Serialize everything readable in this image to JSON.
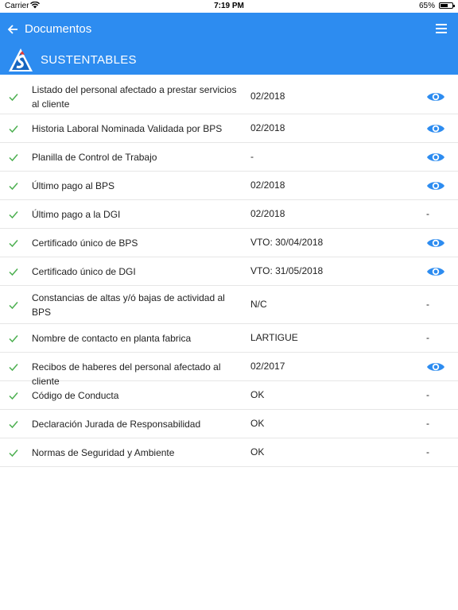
{
  "status_bar": {
    "carrier": "Carrier",
    "time": "7:19 PM",
    "battery": "65%",
    "battery_level": 0.65
  },
  "app_bar": {
    "title": "Documentos",
    "back_icon": "arrow-left-icon",
    "menu_icon": "hamburger-menu-icon"
  },
  "sub_header": {
    "brand": "SUSTENTABLES",
    "logo_icon": "sustentables-logo-icon"
  },
  "colors": {
    "primary": "#2d8cf0",
    "check": "#4caf50",
    "eye": "#2d8cf0"
  },
  "documents": [
    {
      "label": "Listado del personal afectado a prestar servicios al cliente",
      "value": "02/2018",
      "action": "eye"
    },
    {
      "label": "Historia Laboral Nominada Validada por BPS",
      "value": "02/2018",
      "action": "eye"
    },
    {
      "label": "Planilla de Control de Trabajo",
      "value": "-",
      "action": "eye"
    },
    {
      "label": "Último pago al BPS",
      "value": "02/2018",
      "action": "eye"
    },
    {
      "label": "Último pago a la DGI",
      "value": "02/2018",
      "action": "-"
    },
    {
      "label": "Certificado único de BPS",
      "value": "VTO: 30/04/2018",
      "action": "eye"
    },
    {
      "label": "Certificado único de DGI",
      "value": "VTO: 31/05/2018",
      "action": "eye"
    },
    {
      "label": "Constancias de altas y/ó bajas de actividad al BPS",
      "value": "N/C",
      "action": "-"
    },
    {
      "label": "Nombre de contacto en planta fabrica",
      "value": "LARTIGUE",
      "action": "-"
    },
    {
      "label": "Recibos de haberes del personal afectado al cliente",
      "value": "02/2017",
      "action": "eye"
    },
    {
      "label": "Código de Conducta",
      "value": "OK",
      "action": "-"
    },
    {
      "label": "Declaración Jurada de Responsabilidad",
      "value": "OK",
      "action": "-"
    },
    {
      "label": "Normas de Seguridad y Ambiente",
      "value": "OK",
      "action": "-"
    }
  ]
}
